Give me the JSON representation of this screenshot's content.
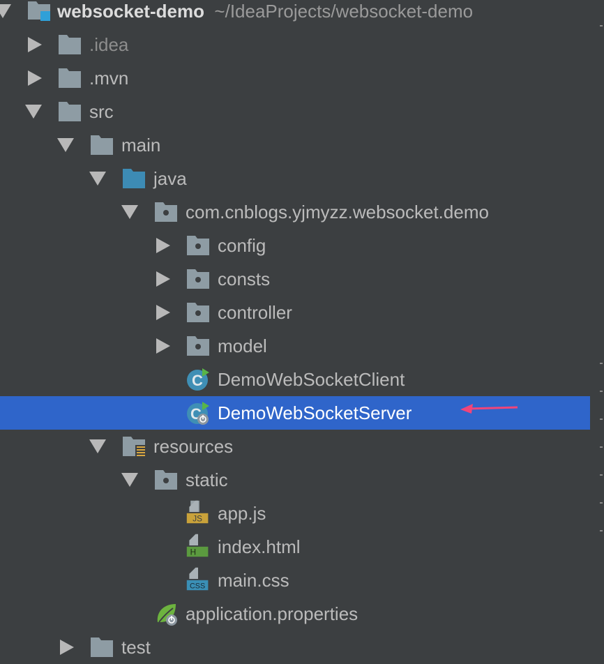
{
  "project": {
    "name": "websocket-demo",
    "path": "~/IdeaProjects/websocket-demo"
  },
  "nodes": {
    "idea": ".idea",
    "mvn": ".mvn",
    "src": "src",
    "main": "main",
    "java": "java",
    "package": "com.cnblogs.yjmyzz.websocket.demo",
    "config": "config",
    "consts": "consts",
    "controller": "controller",
    "model": "model",
    "client_class": "DemoWebSocketClient",
    "server_class": "DemoWebSocketServer",
    "resources": "resources",
    "static": "static",
    "appjs": "app.js",
    "indexhtml": "index.html",
    "maincss": "main.css",
    "appprops": "application.properties",
    "test": "test"
  },
  "icon_labels": {
    "class_letter": "C",
    "js_badge": "JS",
    "html_badge": "H",
    "css_badge": "CSS"
  },
  "colors": {
    "background": "#3c3f41",
    "selection": "#2f65ca",
    "folder": "#8e9ca4",
    "source_folder": "#3d8bb4",
    "annotation_arrow": "#f0457a"
  }
}
